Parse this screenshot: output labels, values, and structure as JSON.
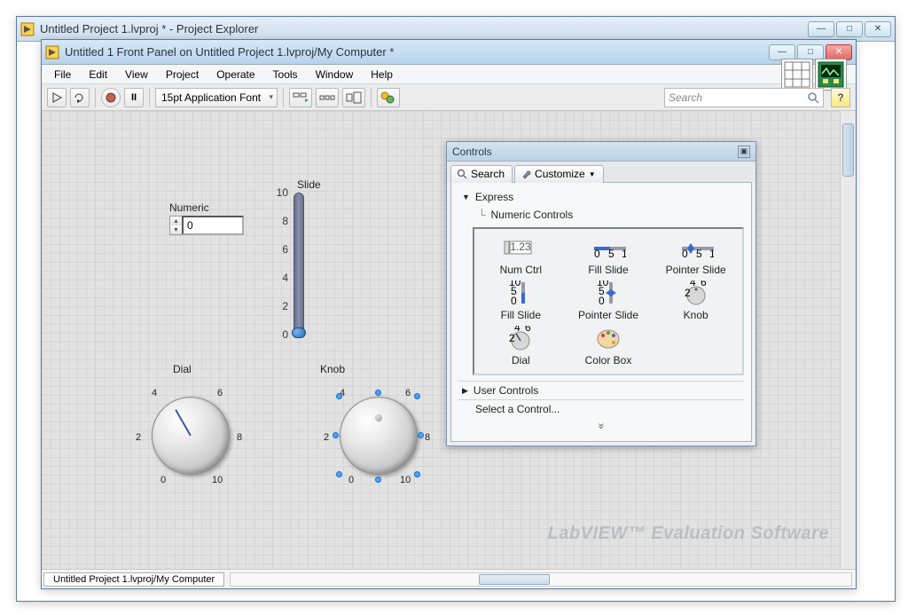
{
  "bg_window": {
    "title": "Untitled Project 1.lvproj * - Project Explorer"
  },
  "fg_window": {
    "title": "Untitled 1 Front Panel on Untitled Project 1.lvproj/My Computer *",
    "menu": [
      "File",
      "Edit",
      "View",
      "Project",
      "Operate",
      "Tools",
      "Window",
      "Help"
    ],
    "toolbar": {
      "font": "15pt Application Font",
      "search_placeholder": "Search"
    },
    "status_tab": "Untitled Project 1.lvproj/My Computer",
    "watermark": "LabVIEW™ Evaluation Software"
  },
  "controls": {
    "numeric": {
      "label": "Numeric",
      "value": "0"
    },
    "slide": {
      "label": "Slide",
      "ticks": [
        "10",
        "8",
        "6",
        "4",
        "2",
        "0"
      ]
    },
    "dial": {
      "label": "Dial",
      "ticks": [
        "0",
        "2",
        "4",
        "6",
        "8",
        "10"
      ]
    },
    "knob": {
      "label": "Knob",
      "ticks": [
        "0",
        "2",
        "4",
        "6",
        "8",
        "10"
      ]
    }
  },
  "palette": {
    "title": "Controls",
    "tabs": {
      "search": "Search",
      "customize": "Customize"
    },
    "category": "Express",
    "subcategory": "Numeric Controls",
    "items": [
      {
        "label": "Num Ctrl"
      },
      {
        "label": "Fill Slide"
      },
      {
        "label": "Pointer Slide"
      },
      {
        "label": "Fill Slide"
      },
      {
        "label": "Pointer Slide"
      },
      {
        "label": "Knob"
      },
      {
        "label": "Dial"
      },
      {
        "label": "Color Box"
      }
    ],
    "user_controls": "User Controls",
    "select_ctrl": "Select a Control...",
    "chevrons": "»"
  }
}
